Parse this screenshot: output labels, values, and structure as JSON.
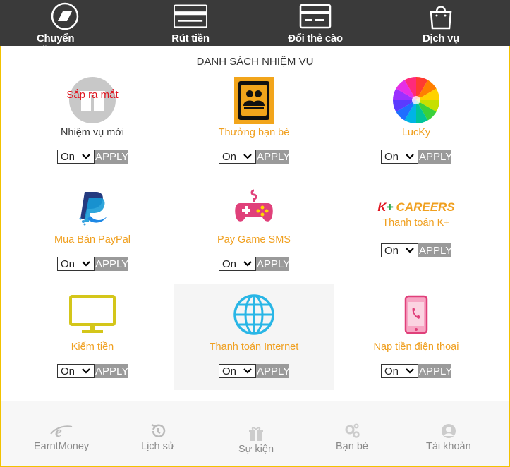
{
  "top_nav": [
    {
      "label": "Chuyển tiền",
      "icon": "transfer-icon"
    },
    {
      "label": "Rút tiền",
      "icon": "card-icon"
    },
    {
      "label": "Đổi thẻ cào",
      "icon": "card-icon"
    },
    {
      "label": "Dịch vụ",
      "icon": "shopping-bag-icon"
    }
  ],
  "title": "DANH SÁCH NHIỆM VỤ",
  "tasks": [
    {
      "name": "Nhiệm vụ mới",
      "badge": "Sắp ra mắt",
      "select": "On",
      "apply": "APPLY",
      "icon": "gift-icon"
    },
    {
      "name": "Thưởng bạn bè",
      "select": "On",
      "apply": "APPLY",
      "icon": "friends-icon"
    },
    {
      "name": "LucKy",
      "select": "On",
      "apply": "APPLY",
      "icon": "color-wheel-icon"
    },
    {
      "name": "Mua Bán PayPal",
      "select": "On",
      "apply": "APPLY",
      "icon": "paypal-icon"
    },
    {
      "name": "Pay Game SMS",
      "select": "On",
      "apply": "APPLY",
      "icon": "gamepad-icon"
    },
    {
      "name": "Thanh toán K+",
      "logo_text": "K+ CAREERS",
      "select": "On",
      "apply": "APPLY",
      "icon": "kplus-logo-icon"
    },
    {
      "name": "Kiếm tiền",
      "select": "On",
      "apply": "APPLY",
      "icon": "monitor-icon"
    },
    {
      "name": "Thanh toán Internet",
      "select": "On",
      "apply": "APPLY",
      "icon": "globe-icon"
    },
    {
      "name": "Nạp tiền điện thoại",
      "select": "On",
      "apply": "APPLY",
      "icon": "phone-icon"
    }
  ],
  "bottom_nav": [
    {
      "label": "EarntMoney",
      "icon": "logo-e-icon"
    },
    {
      "label": "Lịch sử",
      "icon": "history-icon"
    },
    {
      "label": "Sự kiện",
      "icon": "gift-icon"
    },
    {
      "label": "Bạn bè",
      "icon": "gears-icon"
    },
    {
      "label": "Tài khoản",
      "icon": "user-icon"
    }
  ],
  "colors": {
    "top_bar": "#3a3a3a",
    "accent_orange": "#f0a020",
    "apply_gray": "#9a9a9a",
    "frame_yellow": "#f2c200",
    "soon_red": "#e0151f"
  }
}
